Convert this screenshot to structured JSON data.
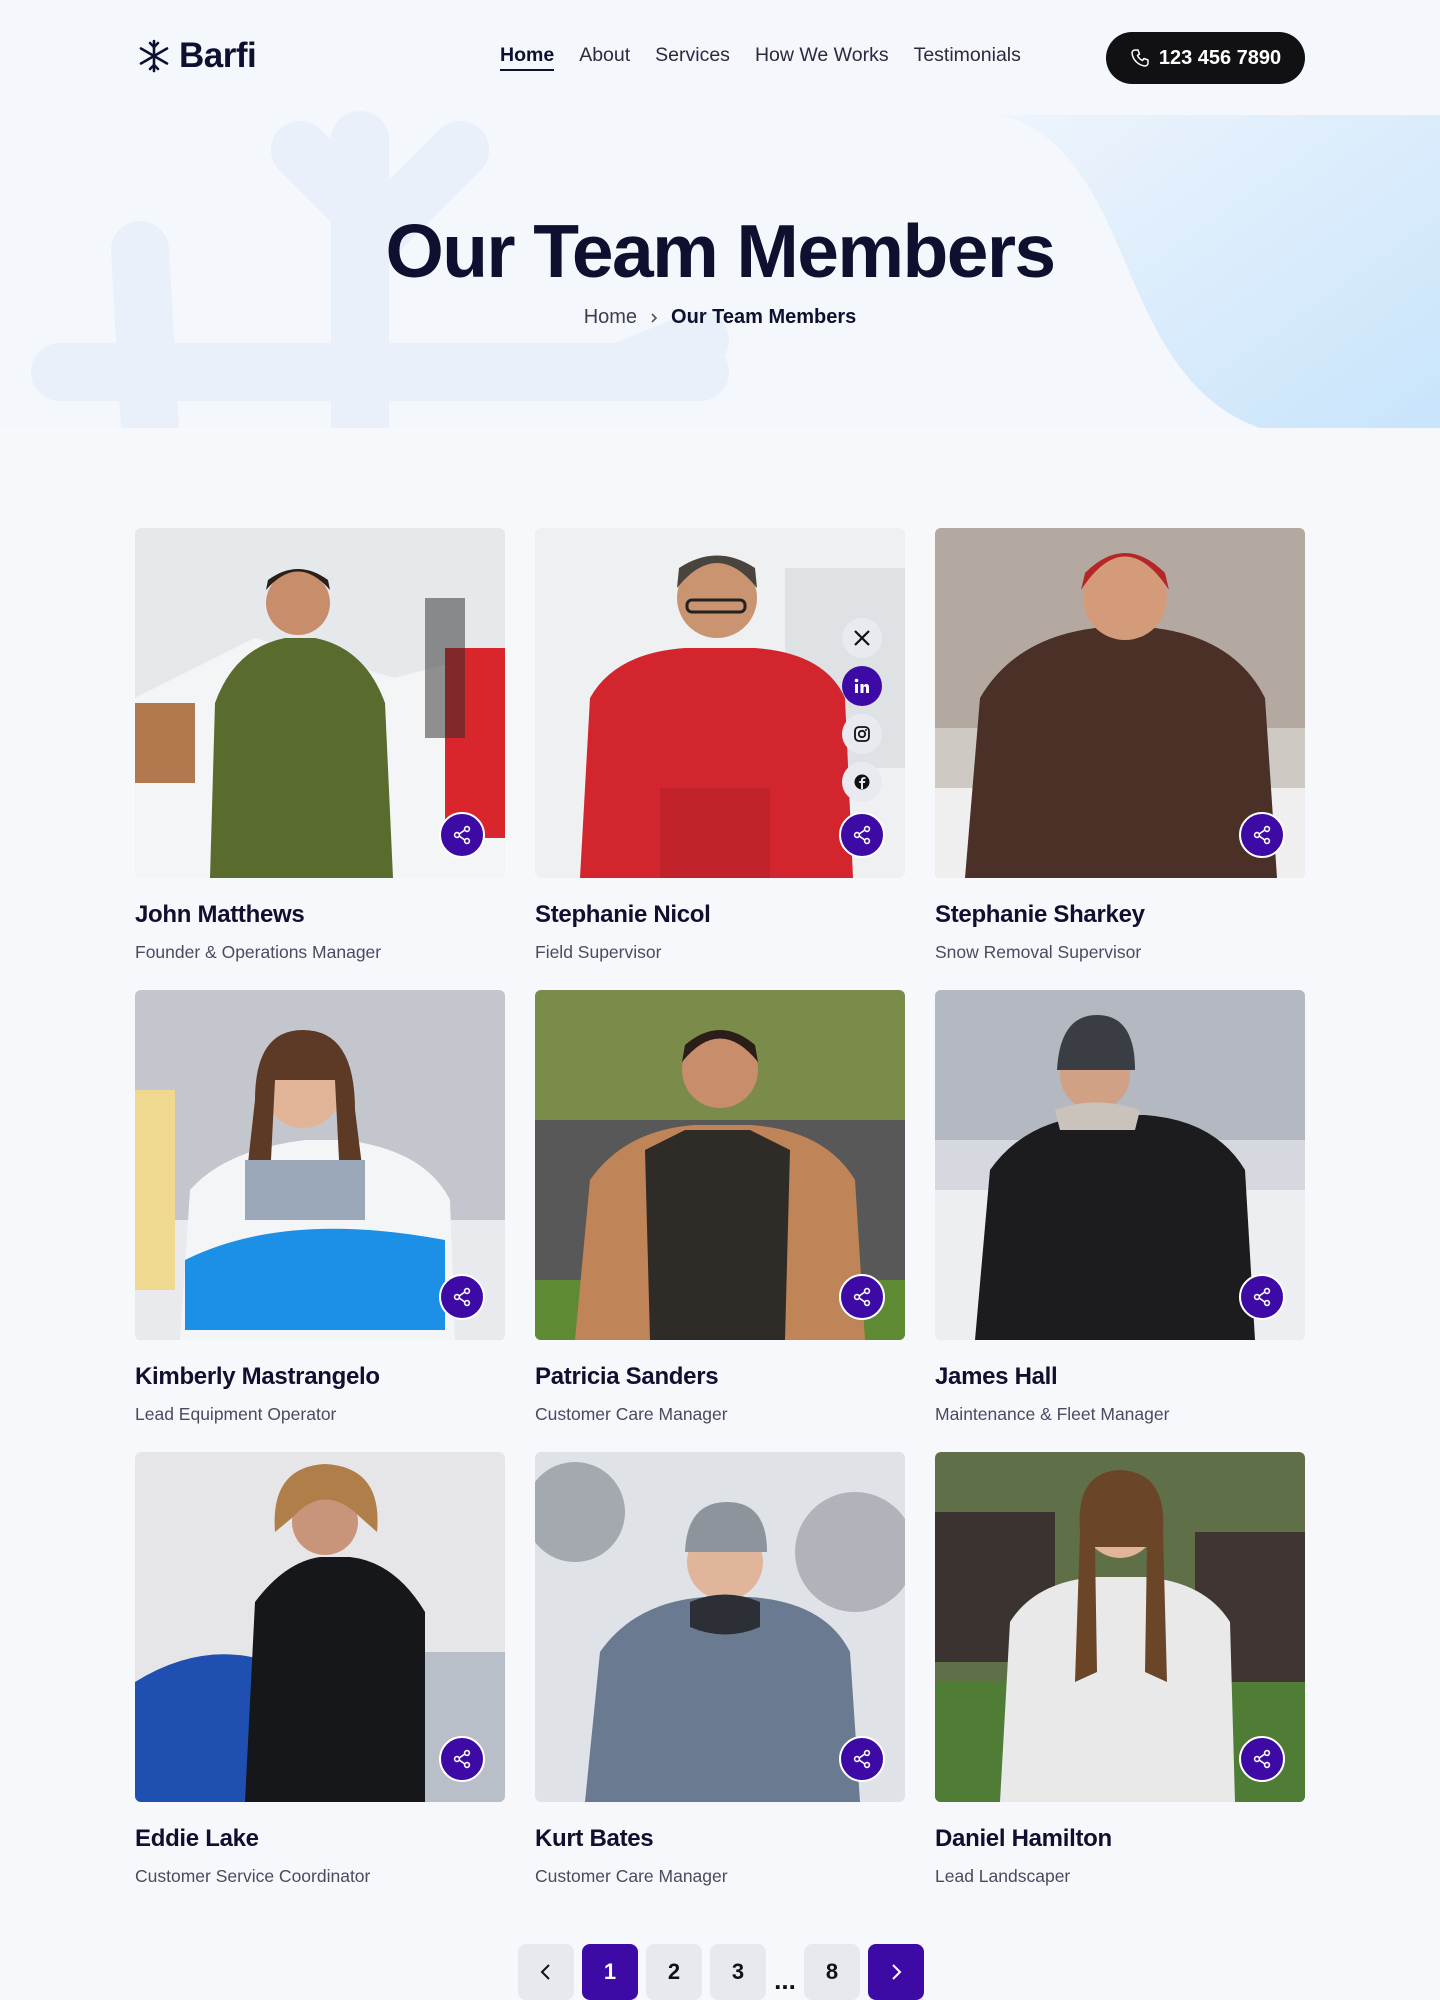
{
  "header": {
    "logo_text": "Barfi",
    "nav": [
      "Home",
      "About",
      "Services",
      "How We Works",
      "Testimonials"
    ],
    "active_nav": "Home",
    "phone": "123 456 7890"
  },
  "hero": {
    "title": "Our Team Members",
    "breadcrumb_home": "Home",
    "breadcrumb_current": "Our Team Members"
  },
  "team": [
    {
      "name": "John Matthews",
      "role": "Founder & Operations Manager"
    },
    {
      "name": "Stephanie Nicol",
      "role": "Field Supervisor"
    },
    {
      "name": "Stephanie Sharkey",
      "role": "Snow Removal Supervisor"
    },
    {
      "name": "Kimberly Mastrangelo",
      "role": "Lead Equipment Operator"
    },
    {
      "name": "Patricia Sanders",
      "role": "Customer Care Manager"
    },
    {
      "name": "James Hall",
      "role": "Maintenance & Fleet Manager"
    },
    {
      "name": "Eddie Lake",
      "role": "Customer Service Coordinator"
    },
    {
      "name": "Kurt Bates",
      "role": "Customer Care Manager"
    },
    {
      "name": "Daniel Hamilton",
      "role": "Lead Landscaper"
    }
  ],
  "social_icons": [
    "x-icon",
    "linkedin-icon",
    "instagram-icon",
    "facebook-icon"
  ],
  "pagination": {
    "pages": [
      "1",
      "2",
      "3",
      "8"
    ],
    "current": "1",
    "ellipsis": "..."
  },
  "colors": {
    "accent": "#3d0aa5",
    "dark": "#0f1030",
    "button_dark": "#111114"
  }
}
